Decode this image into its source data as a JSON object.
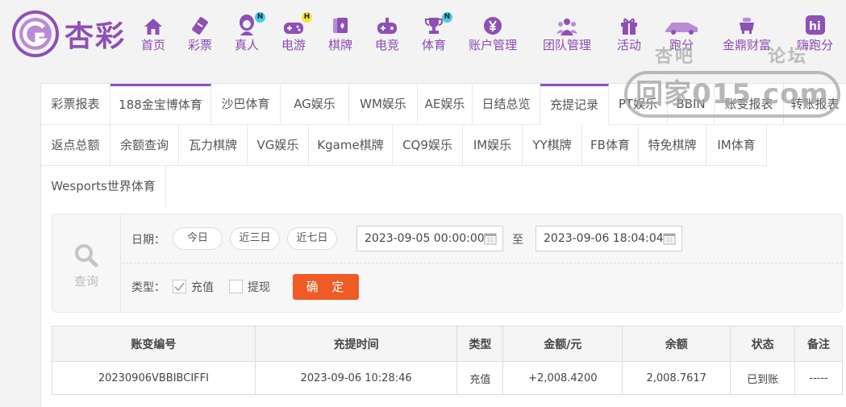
{
  "header": {
    "logo_text": "杏彩",
    "nav": [
      {
        "label": "首页",
        "icon": "home-icon",
        "badge": ""
      },
      {
        "label": "彩票",
        "icon": "lottery-ticket-icon",
        "badge": ""
      },
      {
        "label": "真人",
        "icon": "live-dealer-icon",
        "badge": "N"
      },
      {
        "label": "电游",
        "icon": "gamepad-icon",
        "badge": "H"
      },
      {
        "label": "棋牌",
        "icon": "cards-icon",
        "badge": ""
      },
      {
        "label": "电竞",
        "icon": "esports-controller-icon",
        "badge": ""
      },
      {
        "label": "体育",
        "icon": "trophy-icon",
        "badge": "N"
      },
      {
        "label": "账户管理",
        "icon": "yen-coin-icon",
        "badge": ""
      },
      {
        "label": "团队管理",
        "icon": "team-icon",
        "badge": ""
      },
      {
        "label": "活动",
        "icon": "gift-icon",
        "badge": ""
      },
      {
        "label": "跑分",
        "icon": "run-score-icon",
        "badge": ""
      },
      {
        "label": "金鼎财富",
        "icon": "wealth-icon",
        "badge": ""
      },
      {
        "label": "嗨跑分",
        "icon": "hi-run-icon",
        "badge": ""
      }
    ],
    "badge_colors": {
      "N": "#3bd0e6",
      "H": "#f5e43a"
    },
    "brand_color": "#8e4fb6"
  },
  "watermark": {
    "line1": "杏吧",
    "line2": "论坛",
    "box": "回家015.com"
  },
  "tabs": [
    "彩票报表",
    "188金宝博体育",
    "沙巴体育",
    "AG娱乐",
    "WM娱乐",
    "AE娱乐",
    "日结总览",
    "充提记录",
    "PT娱乐",
    "BBIN",
    "账变报表",
    "转账报表",
    "返点总额",
    "余额查询",
    "瓦力棋牌",
    "VG娱乐",
    "Kgame棋牌",
    "CQ9娱乐",
    "IM娱乐",
    "YY棋牌",
    "FB体育",
    "特免棋牌",
    "IM体育",
    "Wesports世界体育"
  ],
  "active_tab": "充提记录",
  "search": {
    "side_label": "查询",
    "date_label": "日期：",
    "quick_ranges": [
      "今日",
      "近三日",
      "近七日"
    ],
    "date_from": "2023-09-05 00:00:00",
    "to_label": "至",
    "date_to": "2023-09-06 18:04:04",
    "type_label": "类型：",
    "types": [
      {
        "label": "充值",
        "checked": true
      },
      {
        "label": "提现",
        "checked": false
      }
    ],
    "submit_label": "确 定"
  },
  "table": {
    "headers": [
      "账变编号",
      "充提时间",
      "类型",
      "金额/元",
      "余额",
      "状态",
      "备注"
    ],
    "rows": [
      [
        "20230906VBBIBCIFFI",
        "2023-09-06 10:28:46",
        "充值",
        "+2,008.4200",
        "2,008.7617",
        "已到账",
        "-----"
      ]
    ]
  }
}
